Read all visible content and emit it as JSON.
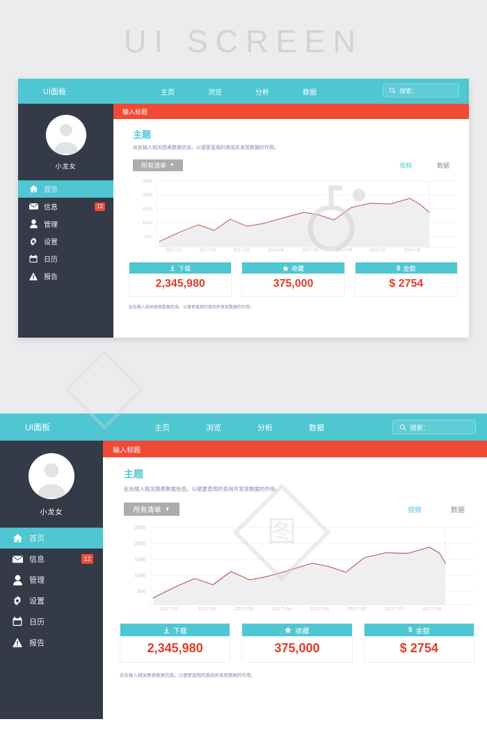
{
  "hero": {
    "title": "UI  SCREEN"
  },
  "navbar": {
    "brand": "UI面板",
    "links": [
      "主页",
      "浏览",
      "分析",
      "数据"
    ],
    "search": {
      "icon": "search-icon",
      "label": "搜索："
    }
  },
  "sidebar": {
    "avatar_icon": "user-avatar-icon",
    "username": "小龙女",
    "items": [
      {
        "label": "首页",
        "icon": "home-icon",
        "active": true,
        "badge": ""
      },
      {
        "label": "信息",
        "icon": "mail-icon",
        "active": false,
        "badge": "12"
      },
      {
        "label": "管理",
        "icon": "user-icon",
        "active": false,
        "badge": ""
      },
      {
        "label": "设置",
        "icon": "gear-icon",
        "active": false,
        "badge": ""
      },
      {
        "label": "日历",
        "icon": "calendar-icon",
        "active": false,
        "badge": ""
      },
      {
        "label": "报告",
        "icon": "warning-icon",
        "active": false,
        "badge": ""
      }
    ]
  },
  "content": {
    "red_bar_title": "输入标题",
    "section_title": "主题",
    "section_desc": "此处输入相关图表数据信息。以便更直观的查阅并发现数据的作用。",
    "dropdown_label": "所有清单",
    "dropdown_caret": "▼",
    "tabs": [
      {
        "label": "视频",
        "active": true
      },
      {
        "label": "数据",
        "active": false
      }
    ],
    "footnote": "此处输入相关图表数据信息。以便更直观的查阅并发现数据的作用。",
    "cards": [
      {
        "icon": "download-icon",
        "label": "下载",
        "value": "2,345,980"
      },
      {
        "icon": "star-icon",
        "label": "收藏",
        "value": "375,000"
      },
      {
        "icon": "dollar-icon",
        "label": "金额",
        "value": "$ 2754"
      }
    ]
  },
  "colors": {
    "teal": "#4ec7d2",
    "red": "#f04a35",
    "value_red": "#e03b28",
    "sidebar": "#343a47",
    "page_bg": "#ececee",
    "line": "#c0736b",
    "area": "#eeeeee",
    "badge": "#ef4b36",
    "dropdown": "#adadad",
    "hero_text": "#d2d3d5"
  },
  "chart_data": {
    "type": "area",
    "title": "主题",
    "xlabel": "",
    "ylabel": "",
    "grid": true,
    "legend": "none",
    "ylim": [
      0,
      2700
    ],
    "yticks": [
      500,
      1000,
      1500,
      2000,
      2500
    ],
    "categories": [
      "2017-01",
      "2017-02",
      "2017-03",
      "2017-04",
      "2017-05",
      "2017-06",
      "2017-07",
      "2017-08"
    ],
    "x": [
      "2017-01",
      "2017-01.5",
      "2017-02",
      "2017-02.5",
      "2017-03",
      "2017-03.3",
      "2017-04",
      "2017-04.5",
      "2017-05",
      "2017-05.3",
      "2017-05.6",
      "2017-06",
      "2017-06.5",
      "2017-07",
      "2017-07.4",
      "2017-07.7",
      "2017-08"
    ],
    "series": [
      {
        "name": "视频",
        "values": [
          420,
          760,
          1060,
          880,
          1270,
          1010,
          1120,
          1350,
          1580,
          1490,
          1300,
          1730,
          1900,
          1890,
          2080,
          1900,
          1620,
          1780
        ]
      }
    ]
  }
}
